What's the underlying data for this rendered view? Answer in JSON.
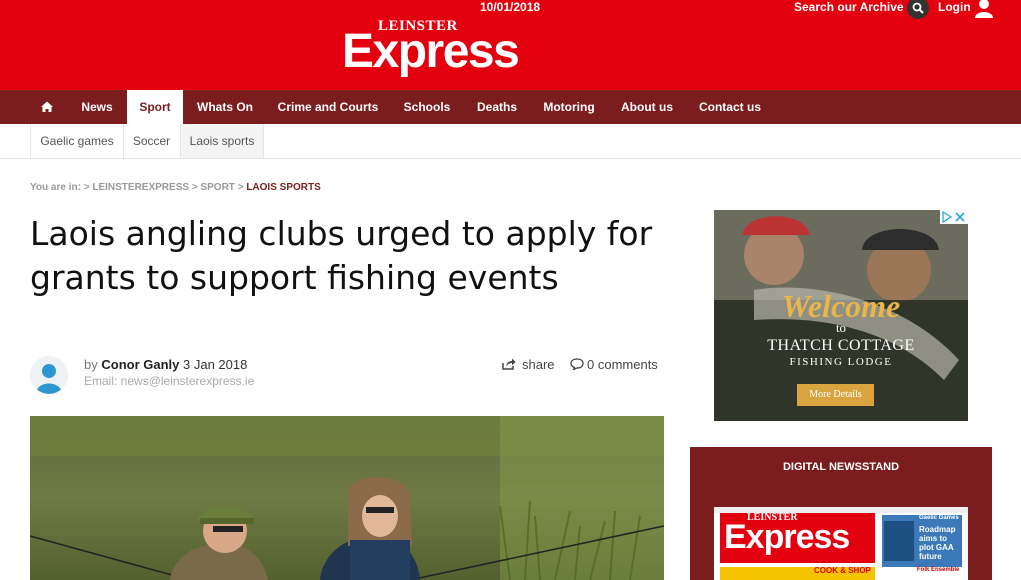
{
  "header": {
    "date": "10/01/2018",
    "search_label": "Search our Archive",
    "login_label": "Login",
    "logo_top": "LEINSTER",
    "logo_main": "Express"
  },
  "nav": {
    "items": [
      "News",
      "Sport",
      "Whats On",
      "Crime and Courts",
      "Schools",
      "Deaths",
      "Motoring",
      "About us",
      "Contact us"
    ],
    "active": "Sport"
  },
  "subnav": {
    "items": [
      "Gaelic games",
      "Soccer",
      "Laois sports"
    ],
    "active": "Laois sports"
  },
  "breadcrumb": {
    "prefix": "You are in:",
    "sep1": ">",
    "crumb1": "LEINSTEREXPRESS",
    "sep2": ">",
    "crumb2": "SPORT",
    "sep3": ">",
    "crumb3": "LAOIS SPORTS"
  },
  "article": {
    "title": "Laois angling clubs urged to apply for grants to support fishing events",
    "by": "by",
    "author": "Conor Ganly",
    "date": "3 Jan 2018",
    "email": "Email: news@leinsterexpress.ie",
    "share_label": "share",
    "comments_label": "0 comments"
  },
  "ad": {
    "welcome": "Welcome",
    "to": "to",
    "name": "THATCH COTTAGE",
    "sub": "FISHING LODGE",
    "button": "More Details"
  },
  "newsstand": {
    "title": "DIGITAL NEWSSTAND",
    "paper_top": "LEINSTER",
    "paper_main": "Express",
    "paper_headline": "Roadmap aims to plot GAA future",
    "paper_kicker": "Gaelic Games",
    "paper_strip": "COOK & SHOP",
    "paper_side": "Folk Ensemble"
  },
  "colors": {
    "brand_red": "#e3000f",
    "nav_maroon": "#7b1c1f"
  }
}
